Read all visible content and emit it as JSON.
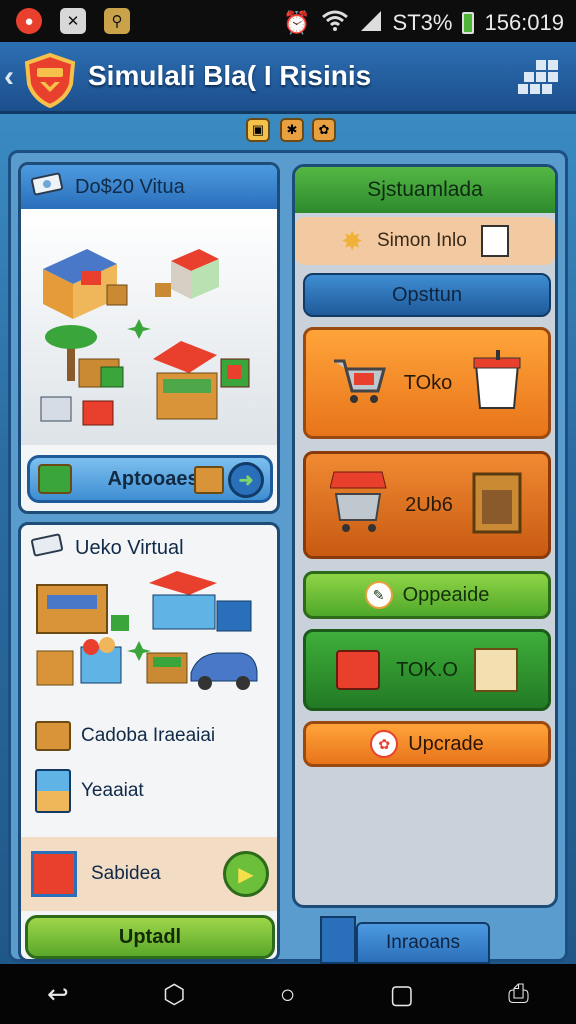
{
  "status_bar": {
    "battery": "ST3%",
    "time": "156:019",
    "icons": [
      "notification-app-icon",
      "sim-icon",
      "usb-icon",
      "alarm-icon",
      "wifi-icon",
      "signal-icon",
      "battery-icon"
    ]
  },
  "header": {
    "title": "Simulali Bla( I Risinis",
    "icons": [
      "back-arrow-icon",
      "shield-logo-icon",
      "grid-menu-icon"
    ]
  },
  "top_badges": [
    "coin-icon",
    "box-icon",
    "star-icon"
  ],
  "left": {
    "card1": {
      "title": "Do$20 Vitua",
      "button": "Aptooaes"
    },
    "card2": {
      "title": "Ueko Virtual",
      "items": [
        "Cadoba Iraeaiai",
        "Yeaaiat"
      ],
      "footer_label": "Sabidea",
      "button": "Uptadl"
    }
  },
  "right": {
    "header": "Sjstuamlada",
    "info": "Simon Inlo",
    "btn_option": "Opsttun",
    "tile1": "TOko",
    "tile2": "2Ub6",
    "btn_upgrade1": "Oppeaide",
    "tile3": "TOK.O",
    "btn_upgrade2": "Upcrade"
  },
  "bottom_tab": "Inraoans",
  "colors": {
    "header_blue": "#2d6fb3",
    "orange": "#f08a22",
    "green": "#4fb53a",
    "dark_green": "#2f9a3a",
    "blue_button": "#2a6fba"
  }
}
